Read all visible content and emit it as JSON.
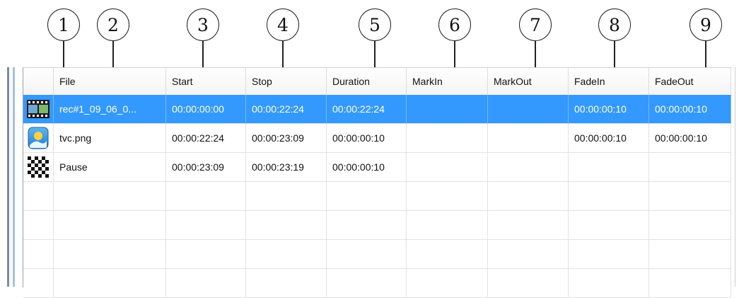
{
  "callouts": [
    "1",
    "2",
    "3",
    "4",
    "5",
    "6",
    "7",
    "8",
    "9"
  ],
  "columns": [
    "File",
    "Start",
    "Stop",
    "Duration",
    "MarkIn",
    "MarkOut",
    "FadeIn",
    "FadeOut"
  ],
  "rows": [
    {
      "icon": "film-icon",
      "file": "rec#1_09_06_0...",
      "start": "00:00:00:00",
      "stop": "00:00:22:24",
      "duration": "00:00:22:24",
      "markin": "",
      "markout": "",
      "fadein": "00:00:00:10",
      "fadeout": "00:00:00:10",
      "selected": true
    },
    {
      "icon": "image-icon",
      "file": "tvc.png",
      "start": "00:00:22:24",
      "stop": "00:00:23:09",
      "duration": "00:00:00:10",
      "markin": "",
      "markout": "",
      "fadein": "00:00:00:10",
      "fadeout": "00:00:00:10",
      "selected": false
    },
    {
      "icon": "checkerboard-pause-icon",
      "file": "Pause",
      "start": "00:00:23:09",
      "stop": "00:00:23:19",
      "duration": "00:00:00:10",
      "markin": "",
      "markout": "",
      "fadein": "",
      "fadeout": "",
      "selected": false
    }
  ],
  "colors": {
    "selection": "#3399ff",
    "selection_text": "#ffffff"
  }
}
